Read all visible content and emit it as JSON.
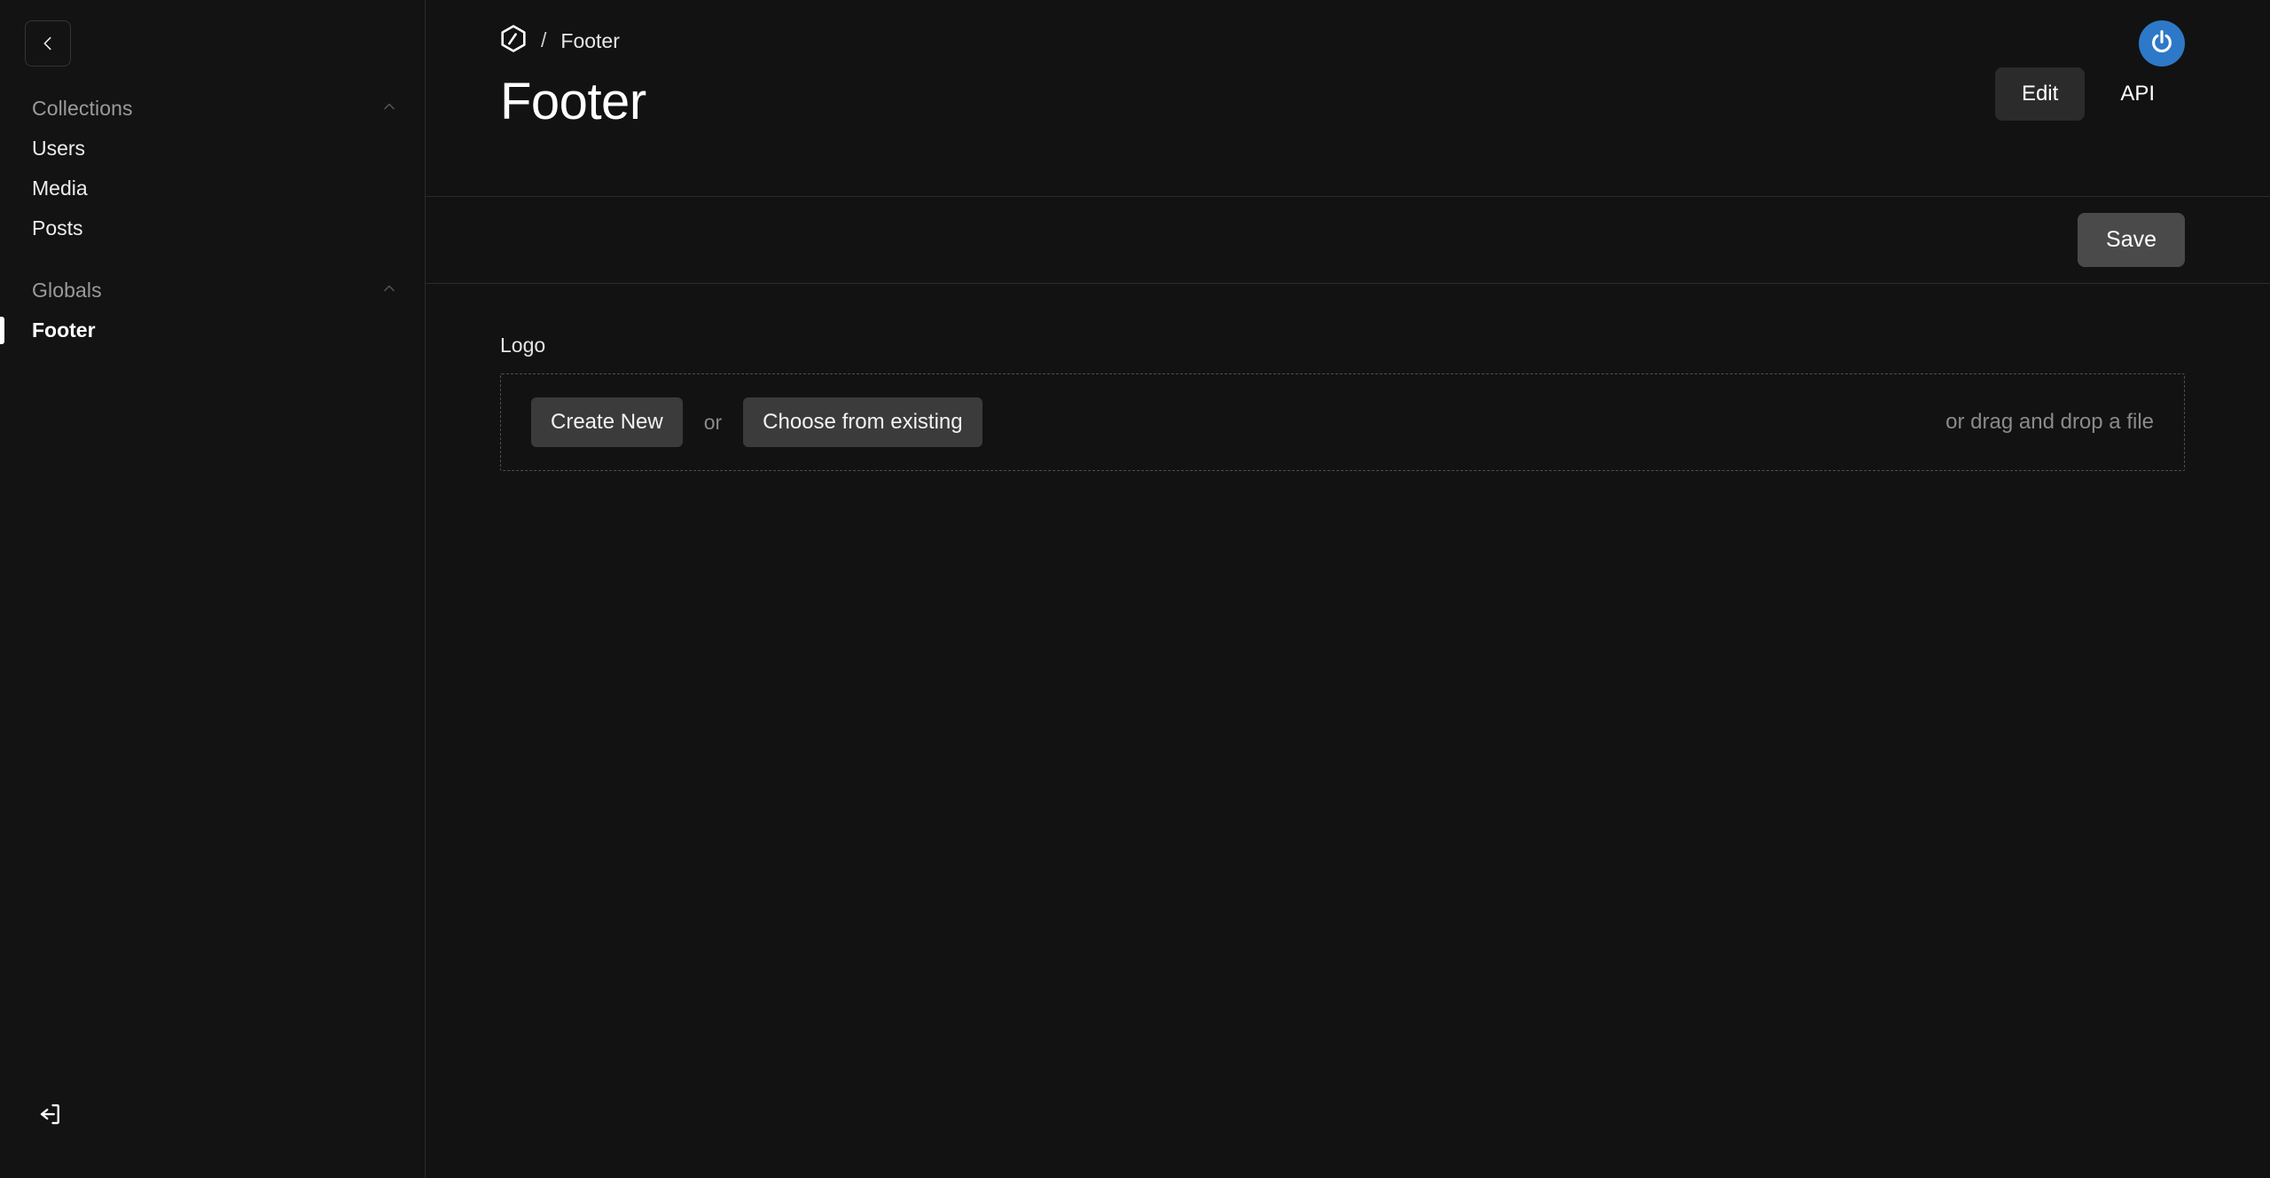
{
  "app": {
    "brand_icon": "payload-logo-icon",
    "background": "#121212",
    "accent": "#2d79c7"
  },
  "sidebar": {
    "collapse_button_icon": "chevron-left-icon",
    "groups": [
      {
        "title": "Collections",
        "toggle_icon": "chevron-up-icon",
        "items": [
          {
            "label": "Users",
            "active": false
          },
          {
            "label": "Media",
            "active": false
          },
          {
            "label": "Posts",
            "active": false
          }
        ]
      },
      {
        "title": "Globals",
        "toggle_icon": "chevron-up-icon",
        "items": [
          {
            "label": "Footer",
            "active": true
          }
        ]
      }
    ],
    "logout_icon": "logout-icon"
  },
  "header": {
    "breadcrumb": {
      "logo_icon": "payload-logo-icon",
      "separator": "/",
      "current": "Footer"
    },
    "title": "Footer",
    "tabs": [
      {
        "label": "Edit",
        "active": true
      },
      {
        "label": "API",
        "active": false
      }
    ],
    "account_icon": "gravatar-power-icon"
  },
  "actions": {
    "save_label": "Save"
  },
  "form": {
    "fields": [
      {
        "label": "Logo",
        "type": "upload",
        "create_label": "Create New",
        "or_label": "or",
        "choose_label": "Choose from existing",
        "drag_hint": "or drag and drop a file"
      }
    ]
  }
}
